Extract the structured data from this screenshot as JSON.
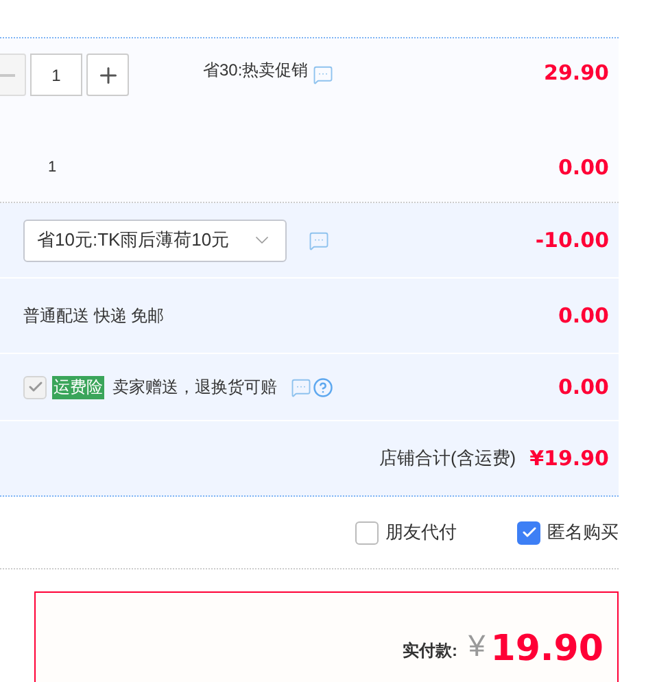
{
  "item": {
    "quantity": "1",
    "promo": "省30:热卖促销",
    "price": "29.90",
    "gift_quantity": "1",
    "gift_price": "0.00"
  },
  "coupon": {
    "value": "省10元:TK雨后薄荷10元",
    "amount": "-10.00"
  },
  "shipping": {
    "label": "普通配送 快递 免邮",
    "amount": "0.00"
  },
  "insurance": {
    "checked": true,
    "disabled": true,
    "badge": "运费险",
    "label": "卖家赠送，退换货可赔",
    "amount": "0.00"
  },
  "shop_total": {
    "label": "店铺合计(含运费)",
    "amount": "¥19.90"
  },
  "options": [
    {
      "label": "朋友代付",
      "checked": false
    },
    {
      "label": "匿名购买",
      "checked": true
    }
  ],
  "payment": {
    "label": "实付款:",
    "currency": "¥",
    "amount": "19.90"
  }
}
